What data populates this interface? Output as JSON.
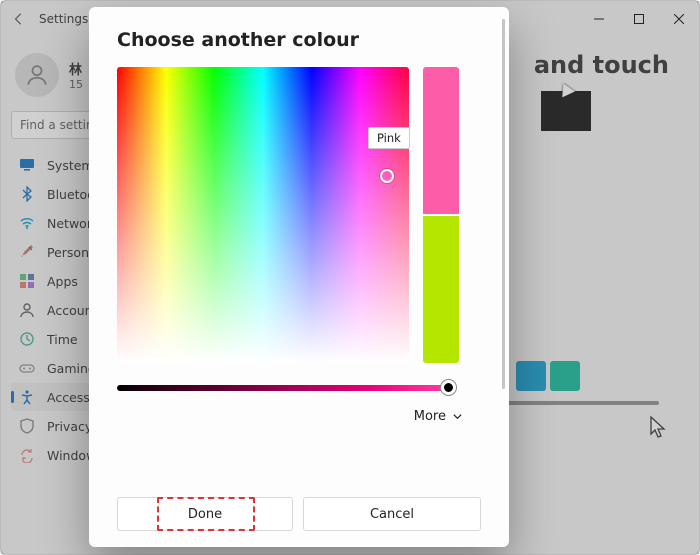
{
  "window": {
    "title": "Settings"
  },
  "profile": {
    "name": "林",
    "sub": "15"
  },
  "search": {
    "placeholder": "Find a setting"
  },
  "sidebar": {
    "items": [
      {
        "label": "System"
      },
      {
        "label": "Bluetooth"
      },
      {
        "label": "Network"
      },
      {
        "label": "Personalisation"
      },
      {
        "label": "Apps"
      },
      {
        "label": "Accounts"
      },
      {
        "label": "Time"
      },
      {
        "label": "Gaming"
      },
      {
        "label": "Accessibility"
      },
      {
        "label": "Privacy"
      },
      {
        "label": "Windows Update"
      }
    ]
  },
  "main": {
    "title_fragment": "and touch",
    "swatches": [
      "#0099cc",
      "#00b694"
    ]
  },
  "dialog": {
    "title": "Choose another colour",
    "tooltip": "Pink",
    "preview_top": "#fd5ca8",
    "preview_bottom": "#b5e600",
    "more": "More",
    "done": "Done",
    "cancel": "Cancel"
  }
}
